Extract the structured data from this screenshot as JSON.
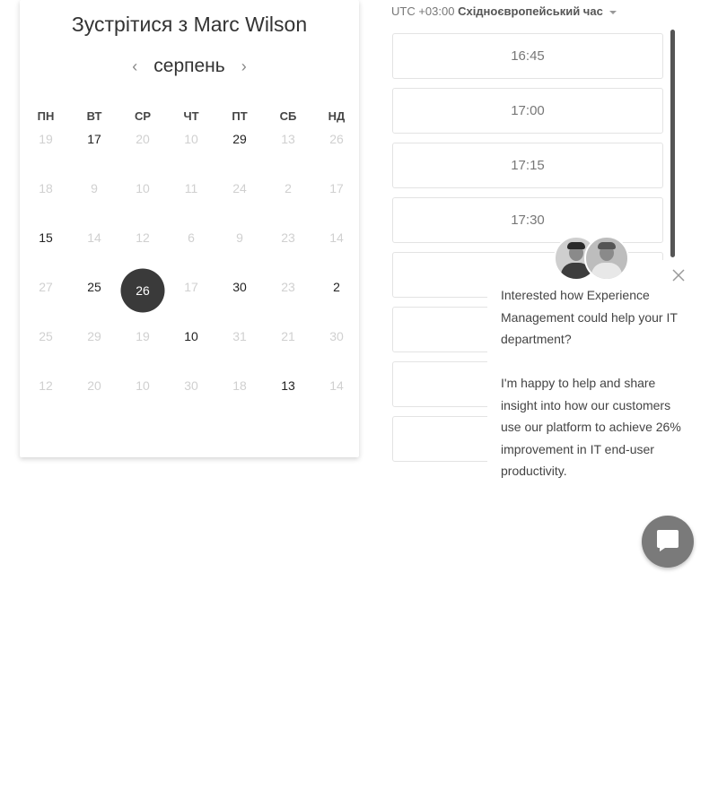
{
  "calendar": {
    "title": "Зустрітися з Marc Wilson",
    "month": "серпень",
    "prev_icon": "chevron-left-icon",
    "next_icon": "chevron-right-icon",
    "weekdays": [
      "ПН",
      "ВТ",
      "СР",
      "ЧТ",
      "ПТ",
      "СБ",
      "НД"
    ],
    "weeks": [
      [
        {
          "n": "19",
          "a": false
        },
        {
          "n": "17",
          "a": true
        },
        {
          "n": "20",
          "a": false
        },
        {
          "n": "10",
          "a": false
        },
        {
          "n": "29",
          "a": true
        },
        {
          "n": "13",
          "a": false
        },
        {
          "n": "26",
          "a": false
        }
      ],
      [
        {
          "n": "18",
          "a": false
        },
        {
          "n": "9",
          "a": false
        },
        {
          "n": "10",
          "a": false
        },
        {
          "n": "11",
          "a": false
        },
        {
          "n": "24",
          "a": false
        },
        {
          "n": "2",
          "a": false
        },
        {
          "n": "17",
          "a": false
        }
      ],
      [
        {
          "n": "15",
          "a": true
        },
        {
          "n": "14",
          "a": false
        },
        {
          "n": "12",
          "a": false
        },
        {
          "n": "6",
          "a": false
        },
        {
          "n": "9",
          "a": false
        },
        {
          "n": "23",
          "a": false
        },
        {
          "n": "14",
          "a": false
        }
      ],
      [
        {
          "n": "27",
          "a": false
        },
        {
          "n": "25",
          "a": true
        },
        {
          "n": "26",
          "a": true,
          "selected": true
        },
        {
          "n": "17",
          "a": false
        },
        {
          "n": "30",
          "a": true
        },
        {
          "n": "23",
          "a": false
        },
        {
          "n": "2",
          "a": true
        }
      ],
      [
        {
          "n": "25",
          "a": false
        },
        {
          "n": "29",
          "a": false
        },
        {
          "n": "19",
          "a": false
        },
        {
          "n": "10",
          "a": true
        },
        {
          "n": "31",
          "a": false
        },
        {
          "n": "21",
          "a": false
        },
        {
          "n": "30",
          "a": false
        }
      ],
      [
        {
          "n": "12",
          "a": false
        },
        {
          "n": "20",
          "a": false
        },
        {
          "n": "10",
          "a": false
        },
        {
          "n": "30",
          "a": false
        },
        {
          "n": "18",
          "a": false
        },
        {
          "n": "13",
          "a": true
        },
        {
          "n": "14",
          "a": false
        }
      ]
    ],
    "selected_color": "#3a3a3a"
  },
  "timezone": {
    "offset": "UTC +03:00",
    "name": "Східноєвропейський час"
  },
  "time_slots": [
    "16:45",
    "17:00",
    "17:15",
    "17:30",
    "",
    "",
    "",
    ""
  ],
  "chat": {
    "message_1": "Interested how Experience Management could help your IT department?",
    "message_2": "I'm happy to help and share insight into how our customers use our platform to achieve 26% improvement in IT end-user productivity.",
    "close_icon": "close-icon",
    "launcher_icon": "chat-bubble-icon"
  }
}
